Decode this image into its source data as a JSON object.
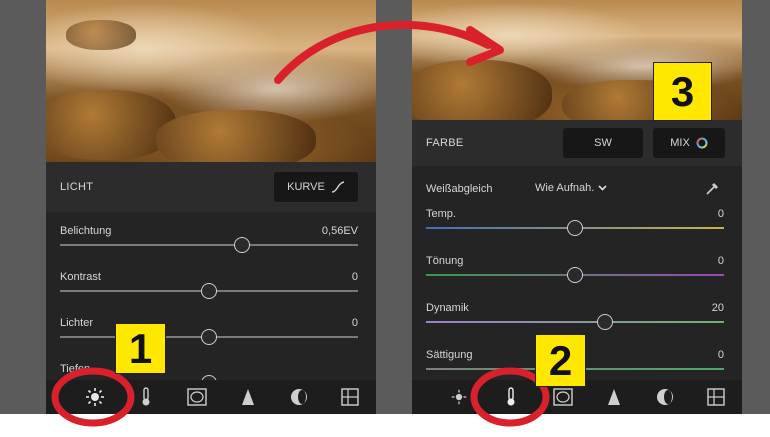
{
  "left_panel": {
    "section_title": "LICHT",
    "curve_button": "KURVE",
    "sliders": [
      {
        "label": "Belichtung",
        "value": "0,56EV",
        "position": 0.61
      },
      {
        "label": "Kontrast",
        "value": "0",
        "position": 0.5
      },
      {
        "label": "Lichter",
        "value": "0",
        "position": 0.5
      },
      {
        "label": "Tiefen",
        "value": "",
        "position": 0.5
      }
    ]
  },
  "right_panel": {
    "section_title": "FARBE",
    "bw_button": "SW",
    "mix_button": "MIX",
    "white_balance_label": "Weißabgleich",
    "white_balance_value": "Wie Aufnah.",
    "sliders": [
      {
        "label": "Temp.",
        "value": "0",
        "position": 0.5
      },
      {
        "label": "Tönung",
        "value": "0",
        "position": 0.5
      },
      {
        "label": "Dynamik",
        "value": "20",
        "position": 0.6
      },
      {
        "label": "Sättigung",
        "value": "0",
        "position": 0.5
      }
    ]
  },
  "toolbar_icons": [
    "sun-icon",
    "thermometer-icon",
    "vignette-icon",
    "triangle-icon",
    "lens-icon",
    "grid-icon"
  ],
  "callouts": {
    "one": "1",
    "two": "2",
    "three": "3"
  },
  "colors": {
    "highlight_yellow": "#ffe800",
    "annotation_red": "#d8212a",
    "panel_bg": "#242424"
  }
}
